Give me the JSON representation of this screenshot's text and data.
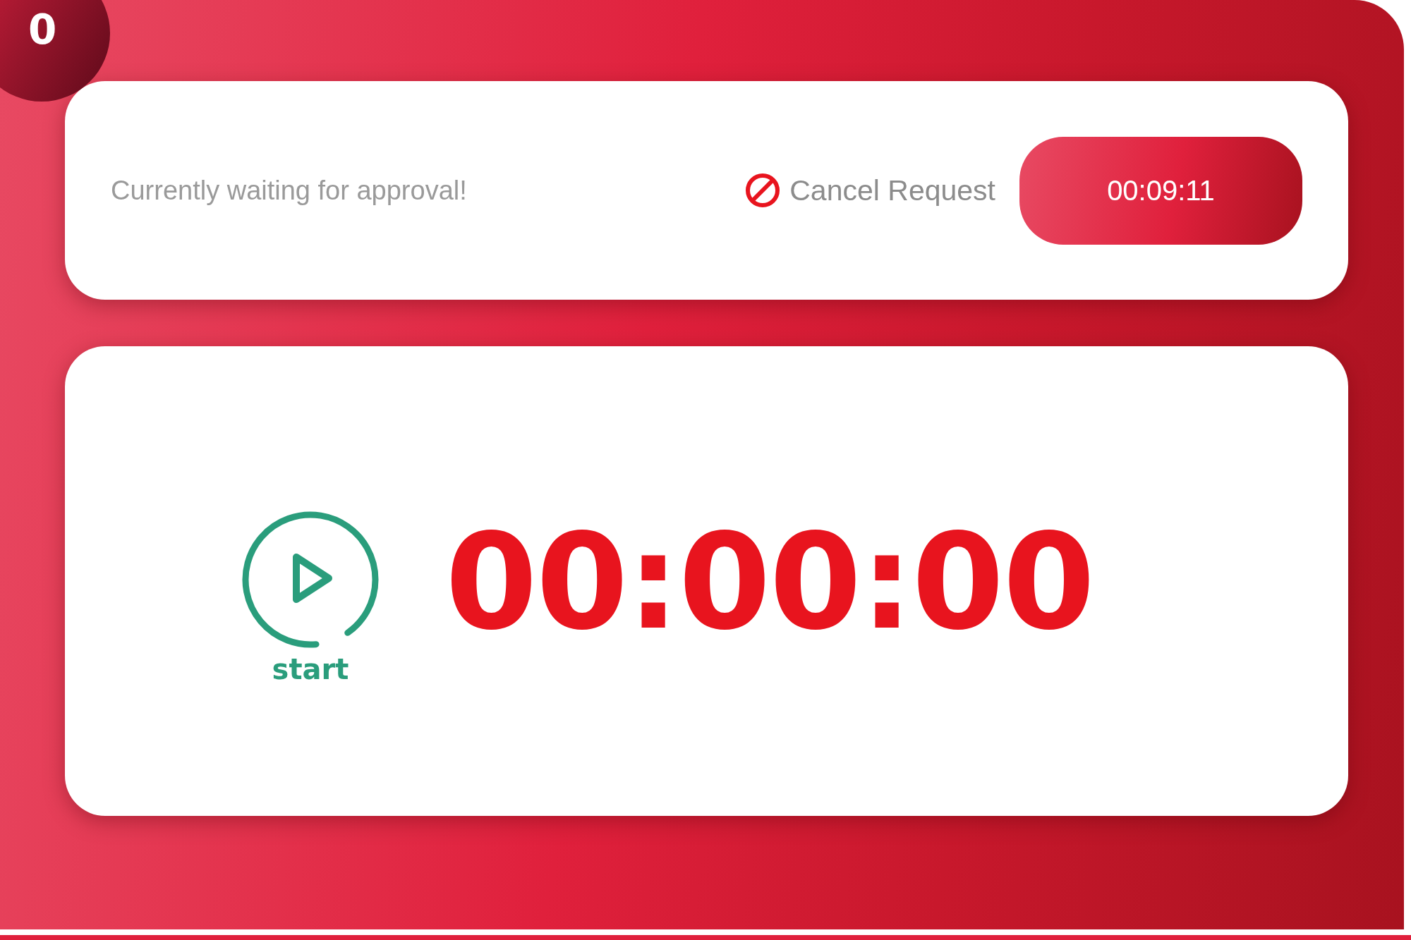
{
  "badge": "0",
  "request": {
    "message": "Currently waiting for approval!",
    "cancel_label": "Cancel Request",
    "elapsed": "00:09:11"
  },
  "stopwatch": {
    "time": "00:00:00",
    "start_label": "start"
  }
}
